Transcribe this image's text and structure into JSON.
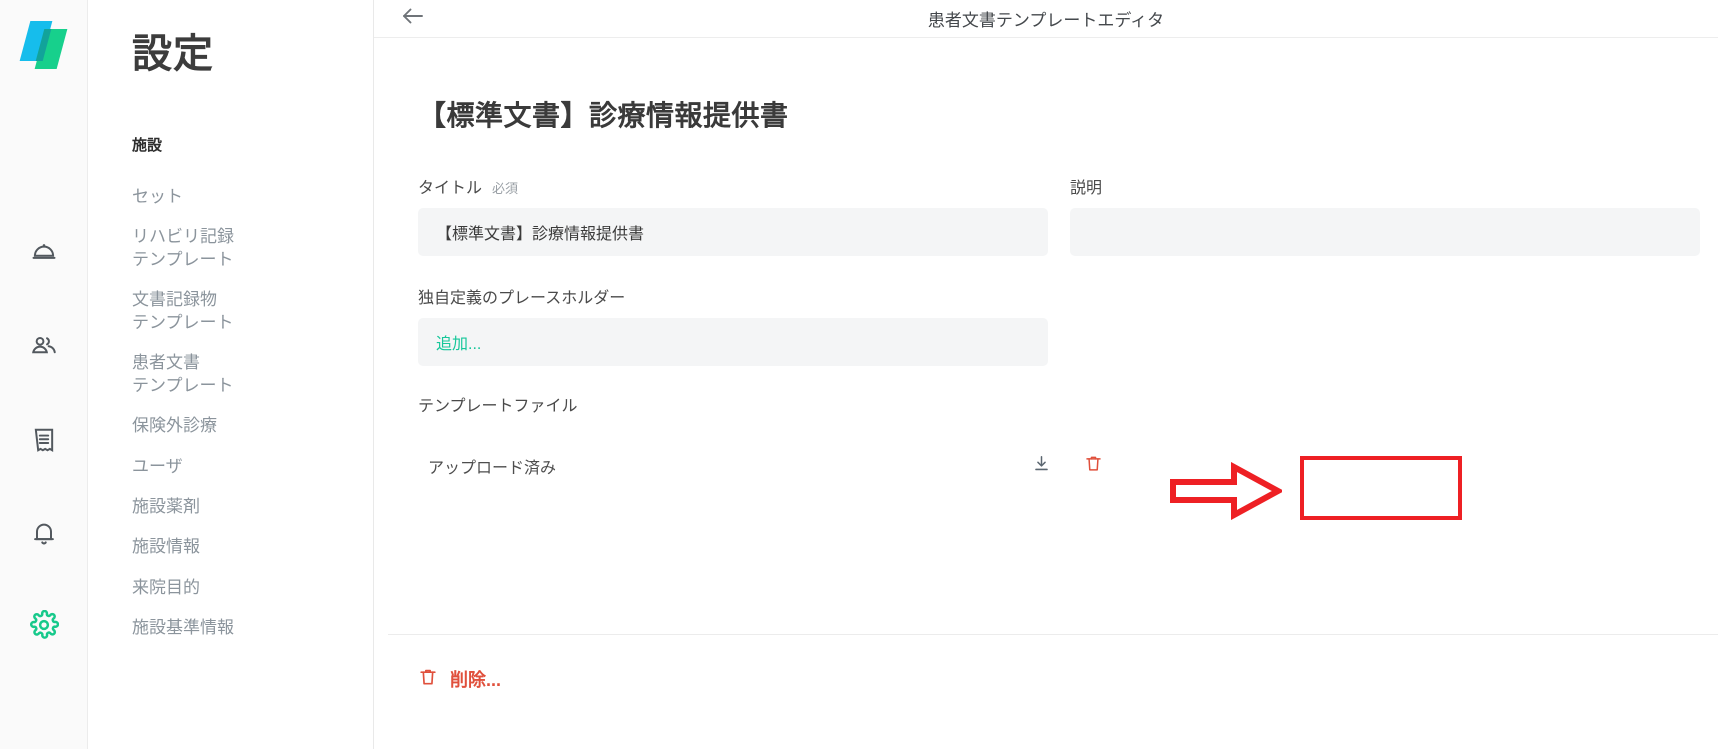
{
  "brand": {
    "logo_icon": "stacked-parallelogram-logo",
    "accent_blue": "#16BDEC",
    "accent_green": "#17D08C"
  },
  "icon_rail": {
    "items": [
      {
        "icon": "room-service-dome-icon",
        "name": "rail-item-service"
      },
      {
        "icon": "people-icon",
        "name": "rail-item-patients"
      },
      {
        "icon": "receipt-icon",
        "name": "rail-item-records"
      },
      {
        "icon": "bell-icon",
        "name": "rail-item-notifications"
      },
      {
        "icon": "gear-icon",
        "name": "rail-item-settings",
        "color": "#17C98B",
        "active": true
      }
    ]
  },
  "sidebar": {
    "title": "設定",
    "section_label": "施設",
    "items": [
      {
        "label": "セット"
      },
      {
        "label": "リハビリ記録\nテンプレート"
      },
      {
        "label": "文書記録物\nテンプレート"
      },
      {
        "label": "患者文書\nテンプレート"
      },
      {
        "label": "保険外診療"
      },
      {
        "label": "ユーザ"
      },
      {
        "label": "施設薬剤"
      },
      {
        "label": "施設情報"
      },
      {
        "label": "来院目的"
      },
      {
        "label": "施設基準情報"
      }
    ]
  },
  "header": {
    "back_icon": "arrow-left-icon",
    "title": "患者文書テンプレートエディタ"
  },
  "main": {
    "document_title": "【標準文書】診療情報提供書",
    "fields": {
      "title": {
        "label": "タイトル",
        "required_badge": "必須",
        "value": "【標準文書】診療情報提供書",
        "placeholder": ""
      },
      "description": {
        "label": "説明",
        "value": "",
        "placeholder": ""
      },
      "custom_placeholder": {
        "label": "独自定義のプレースホルダー",
        "add_label": "追加...",
        "add_color": "#16c79a"
      }
    },
    "template_file": {
      "label": "テンプレートファイル",
      "status": "アップロード済み",
      "actions": [
        {
          "icon": "download-icon",
          "name": "download-file-button",
          "color": "#5b6670"
        },
        {
          "icon": "trash-icon",
          "name": "delete-file-button",
          "color": "#e0503c"
        }
      ]
    },
    "delete": {
      "icon": "trash-icon",
      "label": "削除...",
      "color": "#e0503c"
    }
  },
  "annotations": {
    "arrow": {
      "shape": "right-arrow-outline",
      "color": "#ee2024"
    },
    "highlight_box": {
      "shape": "rectangle-outline",
      "color": "#ee2024"
    }
  }
}
